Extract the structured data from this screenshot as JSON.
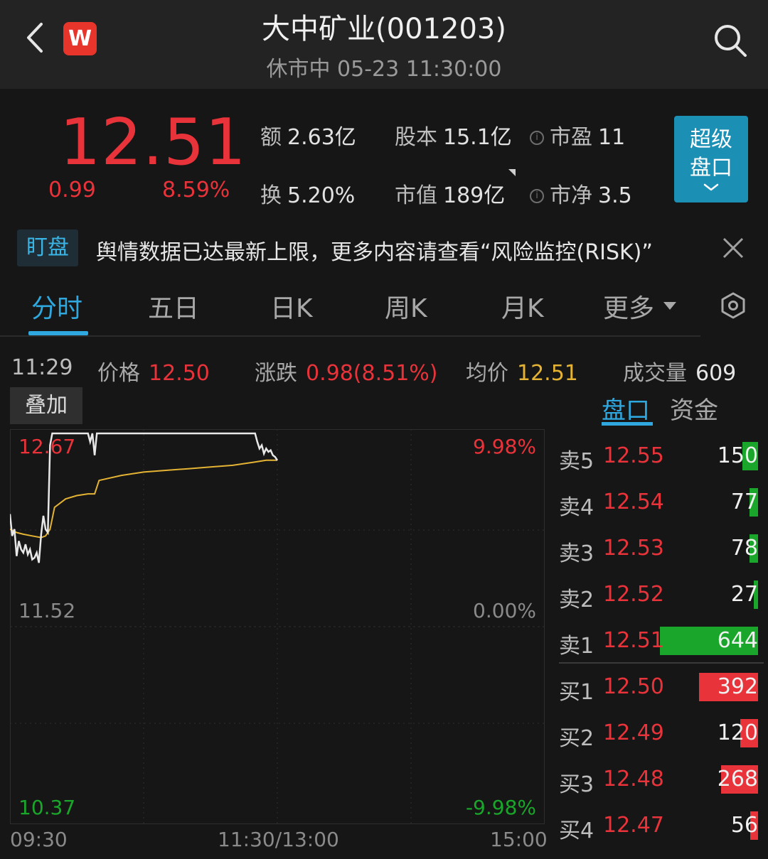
{
  "header": {
    "title": "大中矿业(001203)",
    "subtitle": "休市中 05-23 11:30:00",
    "logo_text": "W",
    "icons": [
      "back-arrow-icon",
      "search-icon"
    ]
  },
  "quote": {
    "price": "12.51",
    "change": "0.99",
    "change_pct": "8.59%",
    "fields": {
      "amount_label": "额",
      "amount_value": "2.63亿",
      "capital_label": "股本",
      "capital_value": "15.1亿",
      "pe_label": "市盈",
      "pe_value": "11",
      "turnover_label": "换",
      "turnover_value": "5.20%",
      "mktcap_label": "市值",
      "mktcap_value": "189亿",
      "pb_label": "市净",
      "pb_value": "3.5"
    },
    "super_button": {
      "line1": "超级",
      "line2": "盘口"
    },
    "info_icon": "i"
  },
  "ticker": {
    "tag": "盯盘",
    "text": "舆情数据已达最新上限，更多内容请查看“风险监控(RISK)”"
  },
  "tabs": [
    "分时",
    "五日",
    "日K",
    "周K",
    "月K",
    "更多"
  ],
  "info_line": {
    "time": "11:29",
    "price_label": "价格",
    "price_value": "12.50",
    "change_label": "涨跌",
    "change_value": "0.98(8.51%)",
    "avg_label": "均价",
    "avg_value": "12.51",
    "volume_label": "成交量",
    "volume_value": "609"
  },
  "overlay_button": "叠加",
  "side_tabs": [
    "盘口",
    "资金"
  ],
  "chart_data": {
    "type": "line",
    "y_ticks_left": [
      "12.67",
      "11.52",
      "10.37"
    ],
    "y_ticks_right": [
      "9.98%",
      "0.00%",
      "-9.98%"
    ],
    "x_ticks": [
      "09:30",
      "11:30/13:00",
      "15:00"
    ],
    "ylim": [
      10.37,
      12.67
    ],
    "total_minutes": 240,
    "series": [
      {
        "role": "price",
        "x": [
          0,
          1,
          2,
          3,
          4,
          5,
          6,
          7,
          8,
          9,
          10,
          11,
          12,
          13,
          14,
          15,
          16,
          17,
          18,
          19,
          20,
          25,
          30,
          35,
          36,
          37,
          38,
          39,
          40,
          50,
          60,
          70,
          80,
          90,
          100,
          110,
          111,
          112,
          113,
          114,
          115,
          116,
          117,
          118,
          119,
          120
        ],
        "values": [
          12.19,
          12.06,
          12.1,
          11.94,
          12.03,
          11.98,
          11.96,
          12.01,
          11.95,
          11.98,
          11.92,
          11.93,
          11.96,
          11.9,
          12.07,
          12.18,
          12.1,
          12.08,
          12.6,
          12.67,
          12.67,
          12.67,
          12.67,
          12.67,
          12.62,
          12.67,
          12.54,
          12.67,
          12.67,
          12.67,
          12.67,
          12.67,
          12.67,
          12.67,
          12.67,
          12.67,
          12.62,
          12.58,
          12.6,
          12.55,
          12.58,
          12.56,
          12.57,
          12.54,
          12.53,
          12.51
        ]
      },
      {
        "role": "average",
        "x": [
          0,
          3,
          6,
          10,
          14,
          16,
          18,
          20,
          25,
          30,
          35,
          38,
          40,
          50,
          60,
          70,
          80,
          90,
          100,
          110,
          115,
          120
        ],
        "values": [
          12.1,
          12.08,
          12.07,
          12.06,
          12.05,
          12.06,
          12.1,
          12.23,
          12.28,
          12.3,
          12.31,
          12.31,
          12.39,
          12.42,
          12.44,
          12.45,
          12.46,
          12.47,
          12.48,
          12.5,
          12.51,
          12.51
        ]
      }
    ],
    "colors": {
      "price": "#e8e8e8",
      "average": "#e4b334",
      "grid": "#2e2e2e"
    }
  },
  "order_book": [
    {
      "label": "卖5",
      "price": "12.55",
      "volume": "150",
      "side": "sell",
      "level": 0.16
    },
    {
      "label": "卖4",
      "price": "12.54",
      "volume": "77",
      "side": "sell",
      "level": 0.09
    },
    {
      "label": "卖3",
      "price": "12.53",
      "volume": "78",
      "side": "sell",
      "level": 0.09
    },
    {
      "label": "卖2",
      "price": "12.52",
      "volume": "27",
      "side": "sell",
      "level": 0.03
    },
    {
      "label": "卖1",
      "price": "12.51",
      "volume": "644",
      "side": "sell",
      "level": 1.0
    },
    {
      "label": "买1",
      "price": "12.50",
      "volume": "392",
      "side": "buy",
      "level": 0.6
    },
    {
      "label": "买2",
      "price": "12.49",
      "volume": "120",
      "side": "buy",
      "level": 0.18
    },
    {
      "label": "买3",
      "price": "12.48",
      "volume": "268",
      "side": "buy",
      "level": 0.38
    },
    {
      "label": "买4",
      "price": "12.47",
      "volume": "56",
      "side": "buy",
      "level": 0.08
    }
  ],
  "colors": {
    "up": "#e8333a",
    "down": "#1aa62a",
    "accent": "#2fa8df",
    "avg": "#e4b334"
  }
}
